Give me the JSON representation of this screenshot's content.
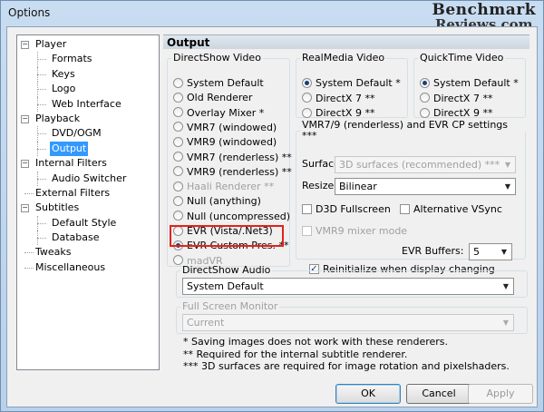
{
  "window": {
    "title": "Options"
  },
  "watermark": {
    "line1": "Benchmark",
    "line2": "Reviews.com"
  },
  "tree": [
    {
      "label": "Player",
      "level": 0,
      "expander": "minus"
    },
    {
      "label": "Formats",
      "level": 1
    },
    {
      "label": "Keys",
      "level": 1
    },
    {
      "label": "Logo",
      "level": 1
    },
    {
      "label": "Web Interface",
      "level": 1
    },
    {
      "label": "Playback",
      "level": 0,
      "expander": "minus"
    },
    {
      "label": "DVD/OGM",
      "level": 1
    },
    {
      "label": "Output",
      "level": 1,
      "selected": true
    },
    {
      "label": "Internal Filters",
      "level": 0,
      "expander": "minus"
    },
    {
      "label": "Audio Switcher",
      "level": 1
    },
    {
      "label": "External Filters",
      "level": 0
    },
    {
      "label": "Subtitles",
      "level": 0,
      "expander": "minus"
    },
    {
      "label": "Default Style",
      "level": 1
    },
    {
      "label": "Database",
      "level": 1
    },
    {
      "label": "Tweaks",
      "level": 0
    },
    {
      "label": "Miscellaneous",
      "level": 0
    }
  ],
  "panel": {
    "title": "Output"
  },
  "directshow_video": {
    "legend": "DirectShow Video",
    "options": [
      {
        "label": "System Default",
        "checked": false,
        "enabled": true
      },
      {
        "label": "Old Renderer",
        "checked": false,
        "enabled": true
      },
      {
        "label": "Overlay Mixer *",
        "checked": false,
        "enabled": true
      },
      {
        "label": "VMR7 (windowed)",
        "checked": false,
        "enabled": true
      },
      {
        "label": "VMR9 (windowed)",
        "checked": false,
        "enabled": true
      },
      {
        "label": "VMR7 (renderless) **",
        "checked": false,
        "enabled": true
      },
      {
        "label": "VMR9 (renderless) **",
        "checked": false,
        "enabled": true
      },
      {
        "label": "Haali Renderer **",
        "checked": false,
        "enabled": false
      },
      {
        "label": "Null (anything)",
        "checked": false,
        "enabled": true
      },
      {
        "label": "Null (uncompressed)",
        "checked": false,
        "enabled": true
      },
      {
        "label": "EVR (Vista/.Net3)",
        "checked": false,
        "enabled": true
      },
      {
        "label": "EVR Custom Pres. **",
        "checked": true,
        "enabled": true
      },
      {
        "label": "madVR",
        "checked": false,
        "enabled": false
      }
    ]
  },
  "realmedia_video": {
    "legend": "RealMedia Video",
    "options": [
      {
        "label": "System Default *",
        "checked": true
      },
      {
        "label": "DirectX 7 **",
        "checked": false
      },
      {
        "label": "DirectX 9 **",
        "checked": false
      }
    ]
  },
  "quicktime_video": {
    "legend": "QuickTime Video",
    "options": [
      {
        "label": "System Default *",
        "checked": true
      },
      {
        "label": "DirectX 7 **",
        "checked": false
      },
      {
        "label": "DirectX 9 **",
        "checked": false
      }
    ]
  },
  "vmr_settings": {
    "legend": "VMR7/9 (renderless) and EVR CP settings ***",
    "surface_label": "Surface:",
    "surface_value": "3D surfaces (recommended) ***",
    "resizer_label": "Resizer:",
    "resizer_value": "Bilinear",
    "d3d_fullscreen": {
      "label": "D3D Fullscreen",
      "checked": false
    },
    "alt_vsync": {
      "label": "Alternative VSync",
      "checked": false
    },
    "vmr9_mixer": {
      "label": "VMR9 mixer mode",
      "checked": false
    },
    "evr_buffers_label": "EVR Buffers:",
    "evr_buffers_value": "5",
    "reinitialize": {
      "label": "Reinitialize when display changing",
      "checked": true
    }
  },
  "directshow_audio": {
    "legend": "DirectShow Audio",
    "value": "System Default"
  },
  "fullscreen_monitor": {
    "legend": "Full Screen Monitor",
    "value": "Current"
  },
  "notes": [
    "* Saving images does not work with these renderers.",
    "** Required for the internal subtitle renderer.",
    "*** 3D surfaces are required for image rotation and pixelshaders."
  ],
  "buttons": {
    "ok": "OK",
    "cancel": "Cancel",
    "apply": "Apply"
  }
}
